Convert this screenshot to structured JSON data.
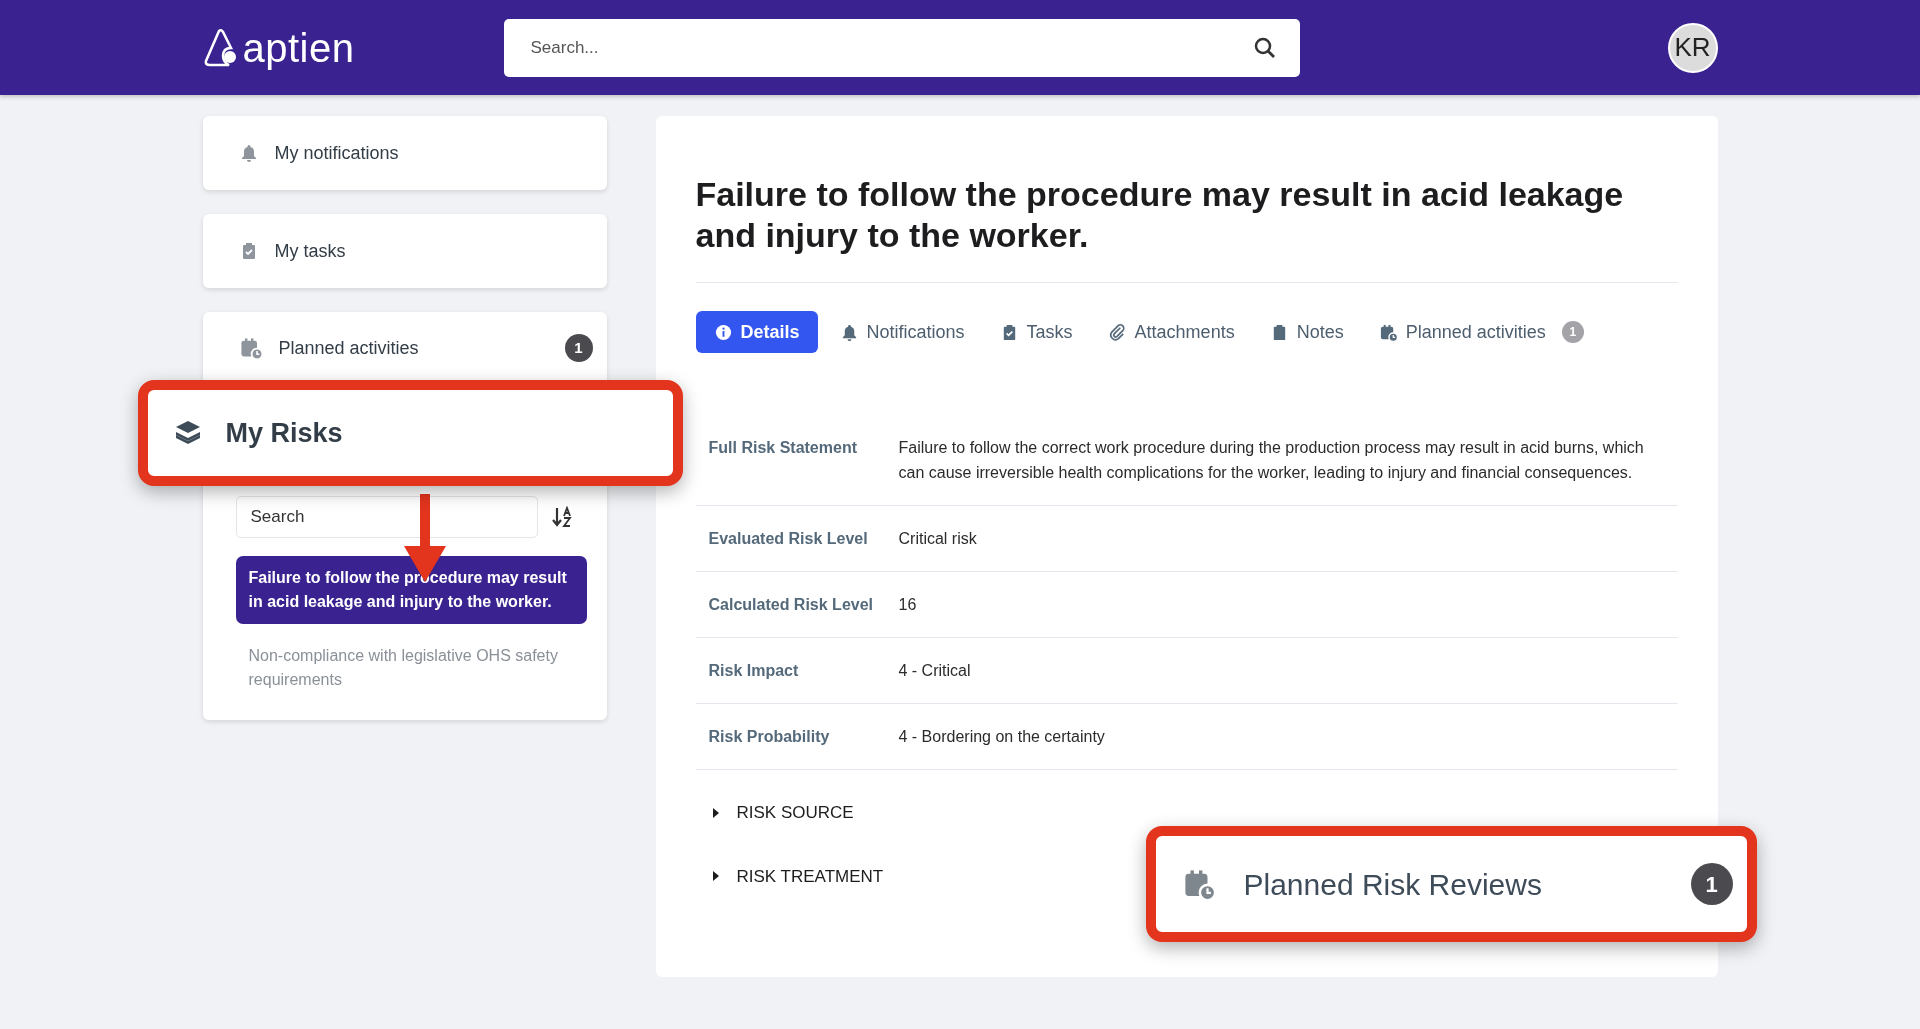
{
  "header": {
    "logo": "aptien",
    "search": {
      "placeholder": "Search..."
    },
    "avatar": "KR"
  },
  "sidebar": {
    "cards": [
      {
        "label": "My notifications",
        "kind": "bell"
      },
      {
        "label": "My tasks",
        "kind": "clipboard"
      }
    ],
    "activities": {
      "label": "Planned activities",
      "kind": "calendar",
      "badge": "1"
    },
    "risks": {
      "title": "My Risks",
      "search": {
        "placeholder": "Search"
      },
      "items": [
        {
          "text": "Failure to follow the procedure may result in acid leakage and injury to the worker.",
          "selected": true
        },
        {
          "text": "Non-compliance with legislative OHS safety requirements",
          "selected": false
        }
      ]
    }
  },
  "detail": {
    "title": "Failure to follow the procedure may result in acid leakage and injury to the worker.",
    "tabs": [
      {
        "label": "Details",
        "kind": "info",
        "selected": true
      },
      {
        "label": "Notifications",
        "kind": "bell",
        "selected": false
      },
      {
        "label": "Tasks",
        "kind": "clipboard",
        "selected": false
      },
      {
        "label": "Attachments",
        "kind": "paperclip",
        "selected": false
      },
      {
        "label": "Notes",
        "kind": "note",
        "selected": false
      },
      {
        "label": "Planned activities",
        "kind": "calendar",
        "badge": "1",
        "selected": false
      }
    ],
    "fields": [
      {
        "label": "Full Risk Statement",
        "value": "Failure to follow the correct work procedure during the production process may result in acid burns, which can cause irreversible health complications for the worker, leading to injury and financial consequences."
      },
      {
        "label": "Evaluated Risk Level",
        "value": "Critical risk"
      },
      {
        "label": "Calculated Risk Level",
        "value": "16"
      },
      {
        "label": "Risk Impact",
        "value": "4 - Critical"
      },
      {
        "label": "Risk Probability",
        "value": "4 - Bordering on the certainty"
      }
    ],
    "sections": [
      {
        "label": "RISK SOURCE",
        "expanded": false
      },
      {
        "label": "RISK TREATMENT",
        "expanded": false
      }
    ]
  },
  "callout": {
    "label": "Planned Risk Reviews",
    "kind": "calendar",
    "badge": "1"
  }
}
